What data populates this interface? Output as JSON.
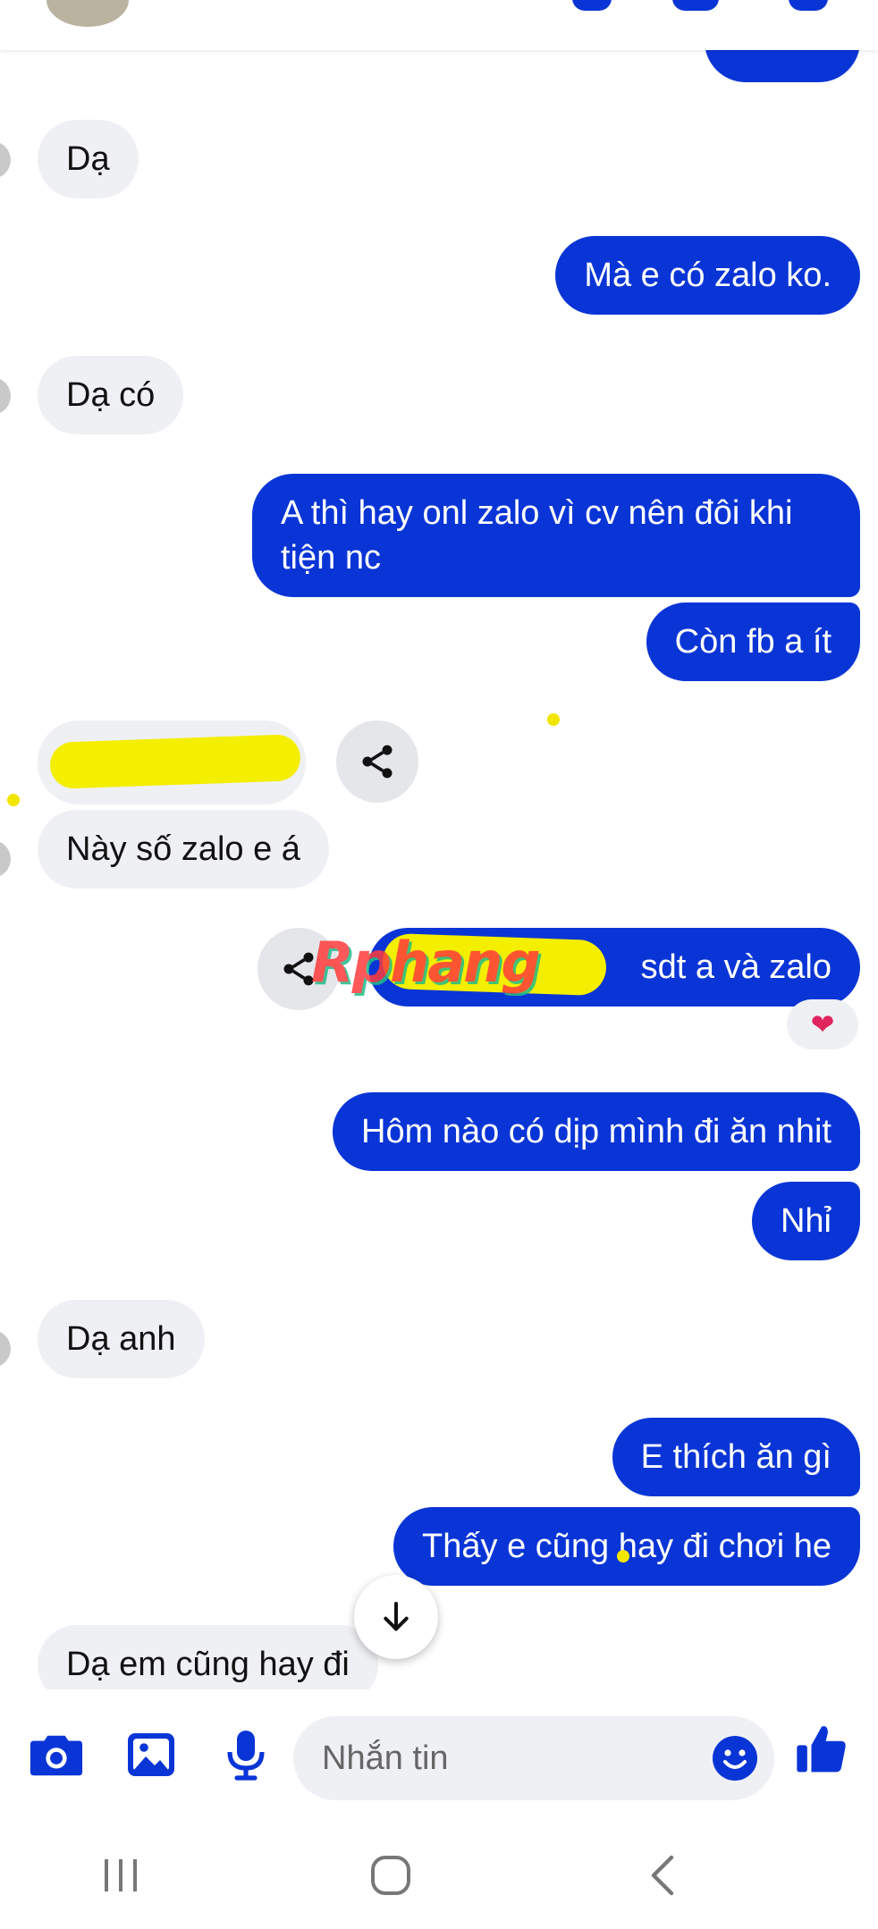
{
  "messages": [
    {
      "text": "Dạ"
    },
    {
      "text": "Mà e có zalo ko."
    },
    {
      "text": "Dạ có"
    },
    {
      "text": "A thì hay onl zalo vì cv nên đôi khi tiện nc"
    },
    {
      "text": "Còn fb a ít"
    },
    {
      "text": "Này số zalo e á"
    },
    {
      "text": "sdt a và zalo"
    },
    {
      "text": "Hôm nào có dịp mình đi ăn nhit"
    },
    {
      "text": "Nhỉ"
    },
    {
      "text": "Dạ anh"
    },
    {
      "text": "E thích ăn gì"
    },
    {
      "text": "Thấy e cũng hay đi chơi he"
    },
    {
      "text": "Dạ em cũng hay đi"
    }
  ],
  "reaction": {
    "icon": "heart-icon",
    "glyph": "❤"
  },
  "watermark": "Rphang",
  "composer": {
    "placeholder": "Nhắn tin"
  },
  "icons": {
    "composer": [
      "camera-icon",
      "gallery-icon",
      "microphone-icon",
      "emoji-icon",
      "thumbs-up-icon"
    ],
    "navigation": [
      "recent-apps-icon",
      "home-icon",
      "back-icon"
    ],
    "chat": [
      "share-icon",
      "arrow-down-icon"
    ]
  },
  "colors": {
    "accent": "#0a35d6",
    "incoming_bubble": "#eff0f4",
    "highlight": "#f4ee00"
  }
}
